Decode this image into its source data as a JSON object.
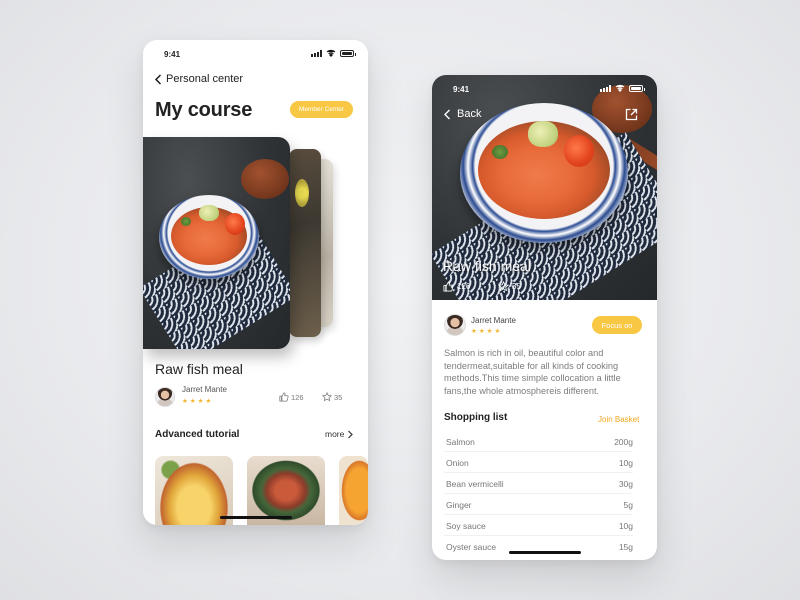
{
  "status": {
    "time": "9:41"
  },
  "left": {
    "back_label": "Personal center",
    "title": "My course",
    "member_button": "Member Center",
    "meal_title": "Raw fish meal",
    "author": "Jarret Mante",
    "rating_stars": "★★★★",
    "likes": "126",
    "favorites": "35",
    "section_title": "Advanced tutorial",
    "more_label": "more"
  },
  "right": {
    "back_label": "Back",
    "meal_title": "Raw fish meal",
    "likes": "126",
    "favorites": "35",
    "author": "Jarret Mante",
    "rating_stars": "★★★★",
    "focus_button": "Focus on",
    "description": "Salmon is rich in oil, beautiful color and tendermeat,suitable for all kinds of cooking methods.This time simple collocation a little fans,the whole atmosphereis different.",
    "shopping_title": "Shopping list",
    "join_label": "Join Basket",
    "shopping_list": [
      {
        "name": "Salmon",
        "qty": "200g"
      },
      {
        "name": "Onion",
        "qty": "10g"
      },
      {
        "name": "Bean vermicelli",
        "qty": "30g"
      },
      {
        "name": "Ginger",
        "qty": "5g"
      },
      {
        "name": "Soy sauce",
        "qty": "10g"
      },
      {
        "name": "Oyster sauce",
        "qty": "15g"
      }
    ]
  },
  "colors": {
    "accent": "#f8c844",
    "link": "#f0a81f",
    "star": "#f3b730"
  },
  "icons": [
    "chevron-left-icon",
    "signal-icon",
    "wifi-icon",
    "battery-icon",
    "thumbs-up-icon",
    "star-outline-icon",
    "share-icon",
    "chevron-right-icon"
  ]
}
